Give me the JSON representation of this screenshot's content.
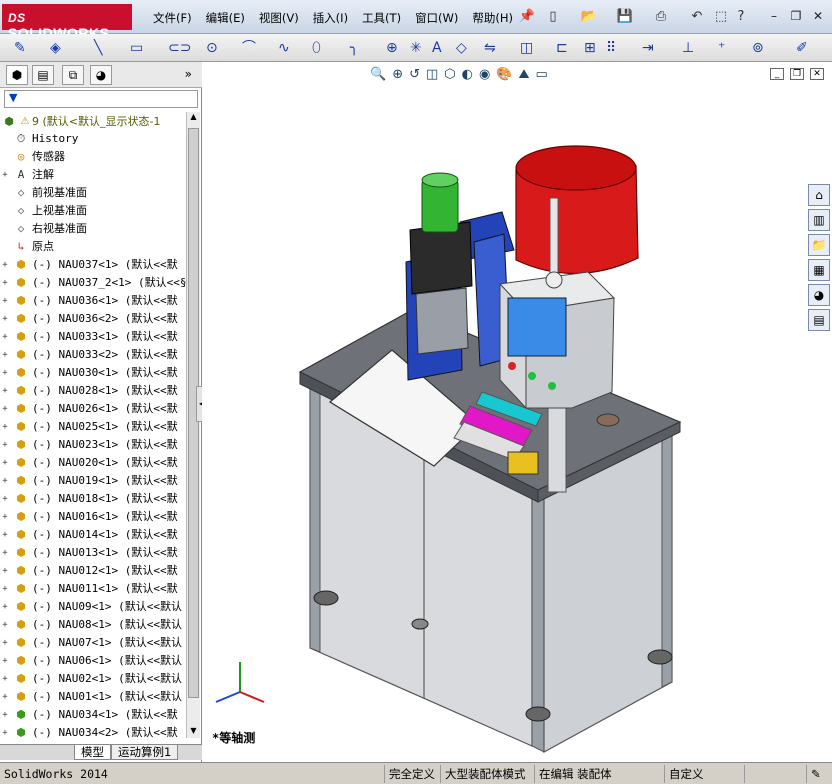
{
  "app": {
    "logo": "SOLIDWORKS",
    "logo_ds": "DS"
  },
  "menu": [
    "文件(F)",
    "编辑(E)",
    "视图(V)",
    "插入(I)",
    "工具(T)",
    "窗口(W)",
    "帮助(H)"
  ],
  "filter": {
    "placeholder": "▼"
  },
  "tree": {
    "root": "9 (默认<默认_显示状态-1",
    "items": [
      {
        "label": "History",
        "icon": "history-icon"
      },
      {
        "label": "传感器",
        "icon": "sensor-icon"
      },
      {
        "label": "注解",
        "icon": "annotation-icon",
        "expand": true
      },
      {
        "label": "前视基准面",
        "icon": "plane-icon"
      },
      {
        "label": "上视基准面",
        "icon": "plane-icon"
      },
      {
        "label": "右视基准面",
        "icon": "plane-icon"
      },
      {
        "label": "原点",
        "icon": "origin-icon"
      },
      {
        "label": "(-) NAU037<1> (默认<<默",
        "icon": "part-icon",
        "expand": true
      },
      {
        "label": "(-) NAU037_2<1> (默认<<§",
        "icon": "part-icon",
        "expand": true
      },
      {
        "label": "(-) NAU036<1> (默认<<默",
        "icon": "part-icon",
        "expand": true
      },
      {
        "label": "(-) NAU036<2> (默认<<默",
        "icon": "part-icon",
        "expand": true
      },
      {
        "label": "(-) NAU033<1> (默认<<默",
        "icon": "part-icon",
        "expand": true
      },
      {
        "label": "(-) NAU033<2> (默认<<默",
        "icon": "part-icon",
        "expand": true
      },
      {
        "label": "(-) NAU030<1> (默认<<默",
        "icon": "part-icon",
        "expand": true
      },
      {
        "label": "(-) NAU028<1> (默认<<默",
        "icon": "part-icon",
        "expand": true
      },
      {
        "label": "(-) NAU026<1> (默认<<默",
        "icon": "part-icon",
        "expand": true
      },
      {
        "label": "(-) NAU025<1> (默认<<默",
        "icon": "part-icon",
        "expand": true
      },
      {
        "label": "(-) NAU023<1> (默认<<默",
        "icon": "part-icon",
        "expand": true
      },
      {
        "label": "(-) NAU020<1> (默认<<默",
        "icon": "part-icon",
        "expand": true
      },
      {
        "label": "(-) NAU019<1> (默认<<默",
        "icon": "part-icon",
        "expand": true
      },
      {
        "label": "(-) NAU018<1> (默认<<默",
        "icon": "part-icon",
        "expand": true
      },
      {
        "label": "(-) NAU016<1> (默认<<默",
        "icon": "part-icon",
        "expand": true
      },
      {
        "label": "(-) NAU014<1> (默认<<默",
        "icon": "part-icon",
        "expand": true
      },
      {
        "label": "(-) NAU013<1> (默认<<默",
        "icon": "part-icon",
        "expand": true
      },
      {
        "label": "(-) NAU012<1> (默认<<默",
        "icon": "part-icon",
        "expand": true
      },
      {
        "label": "(-) NAU011<1> (默认<<默",
        "icon": "part-icon",
        "expand": true
      },
      {
        "label": "(-) NAU09<1> (默认<<默认",
        "icon": "part-icon",
        "expand": true
      },
      {
        "label": "(-) NAU08<1> (默认<<默认",
        "icon": "part-icon",
        "expand": true
      },
      {
        "label": "(-) NAU07<1> (默认<<默认",
        "icon": "part-icon",
        "expand": true
      },
      {
        "label": "(-) NAU06<1> (默认<<默认",
        "icon": "part-icon",
        "expand": true
      },
      {
        "label": "(-) NAU02<1> (默认<<默认",
        "icon": "part-icon",
        "expand": true
      },
      {
        "label": "(-) NAU01<1> (默认<<默认",
        "icon": "part-icon",
        "expand": true
      },
      {
        "label": "(-) NAU034<1> (默认<<默",
        "icon": "assembly-icon",
        "expand": true
      },
      {
        "label": "(-) NAU034<2> (默认<<默",
        "icon": "assembly-icon",
        "expand": true
      }
    ]
  },
  "bottom_tabs": [
    "模型",
    "运动算例1"
  ],
  "view_label": "*等轴测",
  "status": {
    "app": "SolidWorks 2014",
    "fully_defined": "完全定义",
    "mode": "大型装配体模式",
    "editing": "在编辑 装配体",
    "custom": "自定义"
  },
  "colors": {
    "accent": "#c8102e",
    "hopper_red": "#d81a1a",
    "cylinder_green": "#33b433",
    "blue": "#2244b8"
  }
}
